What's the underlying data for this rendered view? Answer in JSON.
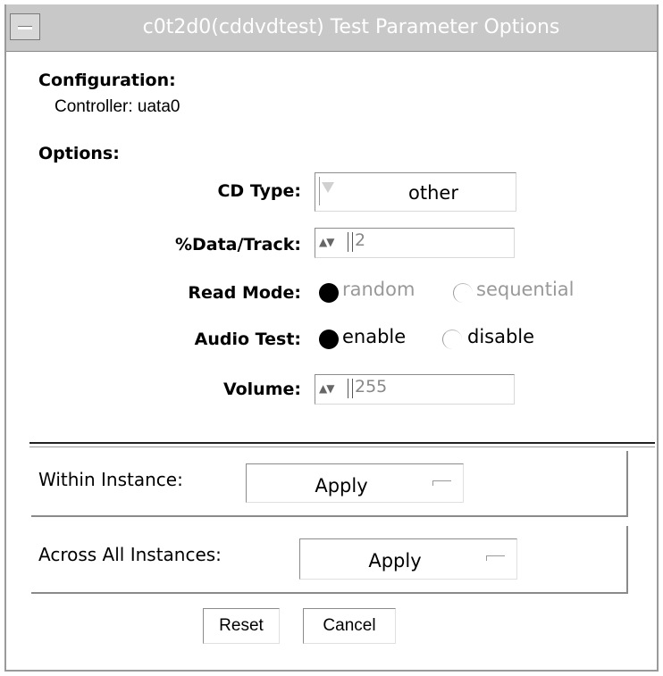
{
  "window": {
    "title": "c0t2d0(cddvdtest) Test Parameter Options"
  },
  "configuration": {
    "heading": "Configuration:",
    "controller": "Controller: uata0"
  },
  "options": {
    "heading": "Options:",
    "cd_type": {
      "label": "CD Type:",
      "value": "other"
    },
    "data_track": {
      "label": "%Data/Track:",
      "value": "2"
    },
    "read_mode": {
      "label": "Read Mode:",
      "option1": "random",
      "option2": "sequential",
      "selected": "random"
    },
    "audio_test": {
      "label": "Audio Test:",
      "option1": "enable",
      "option2": "disable",
      "selected": "enable"
    },
    "volume": {
      "label": "Volume:",
      "value": "255"
    }
  },
  "within_instance": {
    "label": "Within Instance:",
    "button": "Apply"
  },
  "across_instances": {
    "label": "Across All Instances:",
    "button": "Apply"
  },
  "footer": {
    "reset": "Reset",
    "cancel": "Cancel"
  }
}
